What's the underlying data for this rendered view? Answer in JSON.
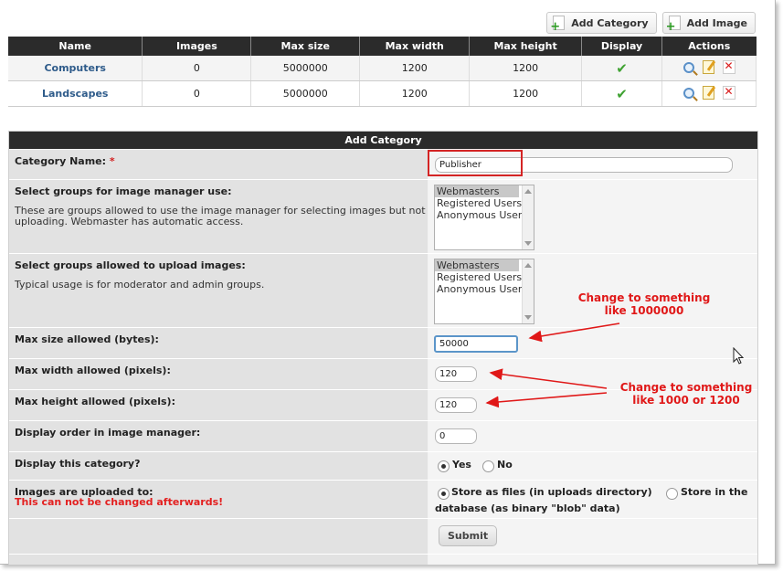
{
  "toolbar": {
    "add_category_label": "Add Category",
    "add_image_label": "Add Image"
  },
  "table": {
    "headers": [
      "Name",
      "Images",
      "Max size",
      "Max width",
      "Max height",
      "Display",
      "Actions"
    ],
    "rows": [
      {
        "name": "Computers",
        "images": "0",
        "max_size": "5000000",
        "max_width": "1200",
        "max_height": "1200"
      },
      {
        "name": "Landscapes",
        "images": "0",
        "max_size": "5000000",
        "max_width": "1200",
        "max_height": "1200"
      }
    ]
  },
  "form": {
    "title": "Add Category",
    "category_name_label": "Category Name:",
    "required_mark": "*",
    "category_name_value": "Publisher",
    "groups_use_label": "Select groups for image manager use:",
    "groups_use_desc": "These are groups allowed to use the image manager for selecting images but not uploading. Webmaster has automatic access.",
    "groups_upload_label": "Select groups allowed to upload images:",
    "groups_upload_desc": "Typical usage is for moderator and admin groups.",
    "group_options": [
      "Webmasters",
      "Registered Users",
      "Anonymous Users"
    ],
    "max_size_label": "Max size allowed (bytes):",
    "max_size_value": "50000",
    "max_width_label": "Max width allowed (pixels):",
    "max_width_value": "120",
    "max_height_label": "Max height allowed (pixels):",
    "max_height_value": "120",
    "display_order_label": "Display order in image manager:",
    "display_order_value": "0",
    "display_label": "Display this category?",
    "yes_label": "Yes",
    "no_label": "No",
    "uploaded_label": "Images are uploaded to:",
    "uploaded_warning": "This can not be changed afterwards!",
    "store_files_label": "Store as files (in uploads directory)",
    "store_db_label_1": "Store in the",
    "store_db_label_2": "database (as binary \"blob\" data)",
    "submit_label": "Submit"
  },
  "annotations": {
    "note1_line1": "Change to something",
    "note1_line2": "like 1000000",
    "note2_line1": "Change to something",
    "note2_line2": "like 1000 or 1200"
  },
  "colors": {
    "annotation": "#e01818",
    "header": "#2b2b2b",
    "link": "#2e5b8a"
  }
}
